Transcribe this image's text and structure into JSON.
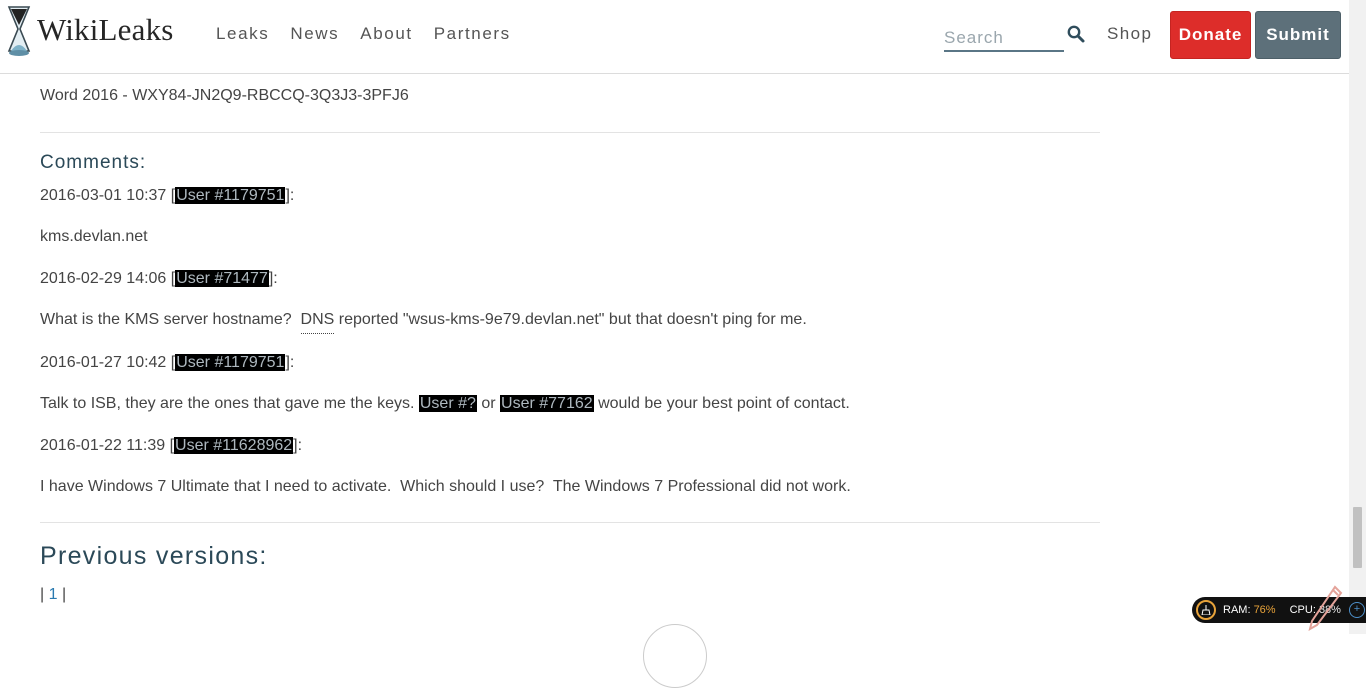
{
  "header": {
    "brand": "WikiLeaks",
    "nav": [
      "Leaks",
      "News",
      "About",
      "Partners"
    ],
    "search_placeholder": "Search",
    "shop": "Shop",
    "donate": "Donate",
    "submit": "Submit",
    "colors": {
      "donate": "#dd2d2a",
      "submit": "#5d707a",
      "title": "#2b4958",
      "link": "#2a7ab0"
    }
  },
  "content": {
    "key_line": "Word 2016 - WXY84-JN2Q9-RBCCQ-3Q3J3-3PFJ6",
    "comments_title": "Comments:",
    "comments": [
      {
        "date": "2016-03-01 10:37",
        "user": "User #1179751",
        "text": "kms.devlan.net"
      },
      {
        "date": "2016-02-29 14:06",
        "user": "User #71477",
        "text_before": "What is the KMS server hostname?  ",
        "abbr": "DNS",
        "text_after": " reported \"wsus-kms-9e79.devlan.net\" but that doesn't ping for me."
      },
      {
        "date": "2016-01-27 10:42",
        "user": "User #1179751",
        "text_before": "Talk to ISB, they are the ones that gave me the keys. ",
        "user_a": "User #?",
        "middle": " or ",
        "user_b": "User #77162",
        "text_after": " would be your best point of contact."
      },
      {
        "date": "2016-01-22 11:39",
        "user": "User #11628962",
        "text": "I have Windows 7 Ultimate that I need to activate.  Which should I use?  The Windows 7 Professional did not work."
      }
    ],
    "previous_versions_title": "Previous versions:",
    "versions": [
      "1"
    ]
  },
  "tray": {
    "ram_label": "RAM:",
    "ram": "76%",
    "cpu_label": "CPU:",
    "cpu": "38%"
  }
}
